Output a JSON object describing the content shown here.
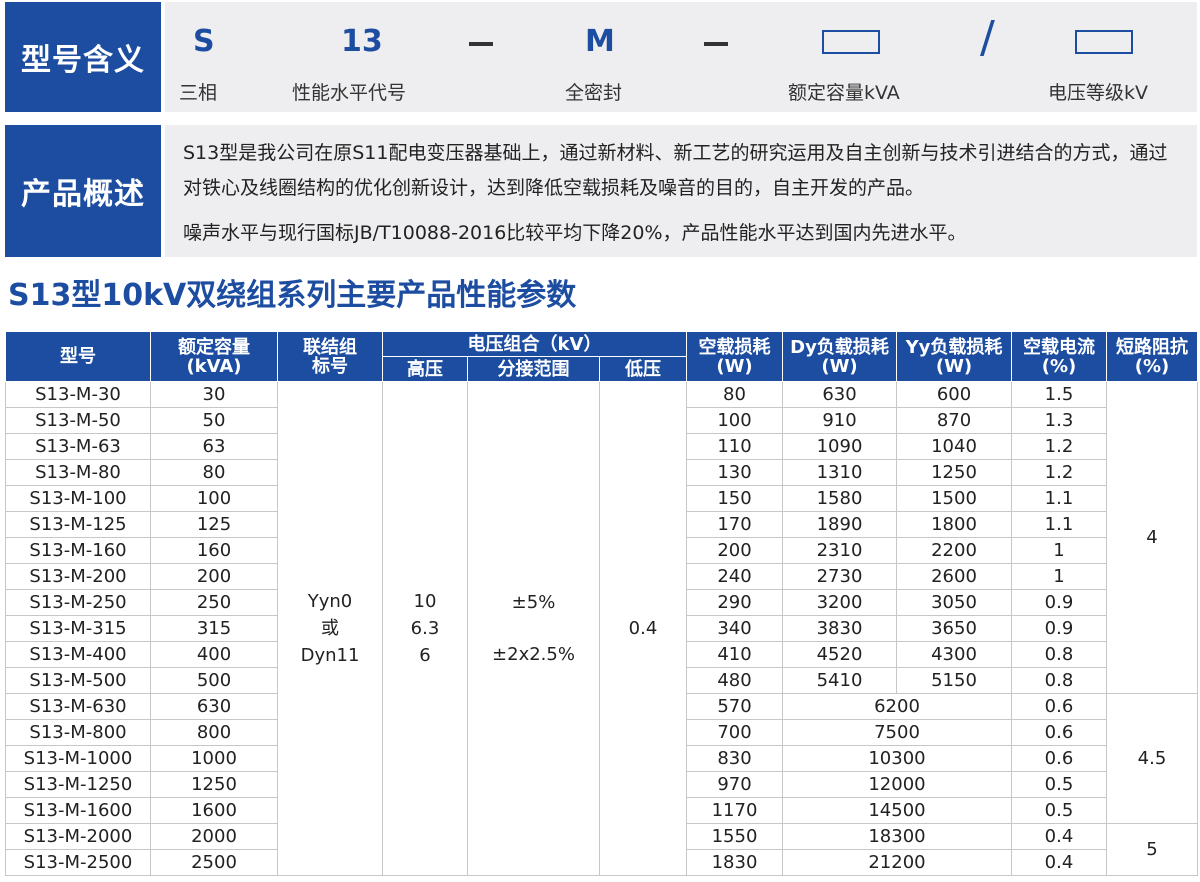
{
  "meaning": {
    "label": "型号含义",
    "s_code": "S",
    "s_desc": "三相",
    "perf_code": "13",
    "perf_desc": "性能水平代号",
    "m_code": "M",
    "m_desc": "全密封",
    "slash": "/",
    "cap_desc": "额定容量kVA",
    "volt_desc": "电压等级kV"
  },
  "overview": {
    "label": "产品概述",
    "para1": "S13型是我公司在原S11配电变压器基础上，通过新材料、新工艺的研究运用及自主创新与技术引进结合的方式，通过对铁心及线圈结构的优化创新设计，达到降低空载损耗及噪音的目的，自主开发的产品。",
    "para2": "噪声水平与现行国标JB/T10088-2016比较平均下降20%，产品性能水平达到国内先进水平。"
  },
  "table_title": "S13型10kV双绕组系列主要产品性能参数",
  "headers": {
    "model": "型号",
    "capacity_l1": "额定容量",
    "capacity_l2": "(kVA)",
    "group_l1": "联结组",
    "group_l2": "标号",
    "voltage": "电压组合（kV）",
    "hv": "高压",
    "tap": "分接范围",
    "lv": "低压",
    "noload_l1": "空载损耗",
    "noload_l2": "(W)",
    "dy_l1": "Dy负载损耗",
    "dy_l2": "(W)",
    "yy_l1": "Yy负载损耗",
    "yy_l2": "(W)",
    "current_l1": "空载电流",
    "current_l2": "(%)",
    "imp_l1": "短路阻抗",
    "imp_l2": "(%)"
  },
  "merged": {
    "group_1": "Yyn0",
    "group_2": "或",
    "group_3": "Dyn11",
    "hv_1": "10",
    "hv_2": "6.3",
    "hv_3": "6",
    "tap_1": "±5%",
    "tap_2": "±2x2.5%",
    "lv": "0.4",
    "imp_a": "4",
    "imp_b": "4.5",
    "imp_c": "5"
  },
  "rows": [
    {
      "model": "S13-M-30",
      "cap": "30",
      "noload": "80",
      "dy": "630",
      "yy": "600",
      "current": "1.5"
    },
    {
      "model": "S13-M-50",
      "cap": "50",
      "noload": "100",
      "dy": "910",
      "yy": "870",
      "current": "1.3"
    },
    {
      "model": "S13-M-63",
      "cap": "63",
      "noload": "110",
      "dy": "1090",
      "yy": "1040",
      "current": "1.2"
    },
    {
      "model": "S13-M-80",
      "cap": "80",
      "noload": "130",
      "dy": "1310",
      "yy": "1250",
      "current": "1.2"
    },
    {
      "model": "S13-M-100",
      "cap": "100",
      "noload": "150",
      "dy": "1580",
      "yy": "1500",
      "current": "1.1"
    },
    {
      "model": "S13-M-125",
      "cap": "125",
      "noload": "170",
      "dy": "1890",
      "yy": "1800",
      "current": "1.1"
    },
    {
      "model": "S13-M-160",
      "cap": "160",
      "noload": "200",
      "dy": "2310",
      "yy": "2200",
      "current": "1"
    },
    {
      "model": "S13-M-200",
      "cap": "200",
      "noload": "240",
      "dy": "2730",
      "yy": "2600",
      "current": "1"
    },
    {
      "model": "S13-M-250",
      "cap": "250",
      "noload": "290",
      "dy": "3200",
      "yy": "3050",
      "current": "0.9"
    },
    {
      "model": "S13-M-315",
      "cap": "315",
      "noload": "340",
      "dy": "3830",
      "yy": "3650",
      "current": "0.9"
    },
    {
      "model": "S13-M-400",
      "cap": "400",
      "noload": "410",
      "dy": "4520",
      "yy": "4300",
      "current": "0.8"
    },
    {
      "model": "S13-M-500",
      "cap": "500",
      "noload": "480",
      "dy": "5410",
      "yy": "5150",
      "current": "0.8"
    },
    {
      "model": "S13-M-630",
      "cap": "630",
      "noload": "570",
      "load": "6200",
      "current": "0.6"
    },
    {
      "model": "S13-M-800",
      "cap": "800",
      "noload": "700",
      "load": "7500",
      "current": "0.6"
    },
    {
      "model": "S13-M-1000",
      "cap": "1000",
      "noload": "830",
      "load": "10300",
      "current": "0.6"
    },
    {
      "model": "S13-M-1250",
      "cap": "1250",
      "noload": "970",
      "load": "12000",
      "current": "0.5"
    },
    {
      "model": "S13-M-1600",
      "cap": "1600",
      "noload": "1170",
      "load": "14500",
      "current": "0.5"
    },
    {
      "model": "S13-M-2000",
      "cap": "2000",
      "noload": "1550",
      "load": "18300",
      "current": "0.4"
    },
    {
      "model": "S13-M-2500",
      "cap": "2500",
      "noload": "1830",
      "load": "21200",
      "current": "0.4"
    }
  ]
}
